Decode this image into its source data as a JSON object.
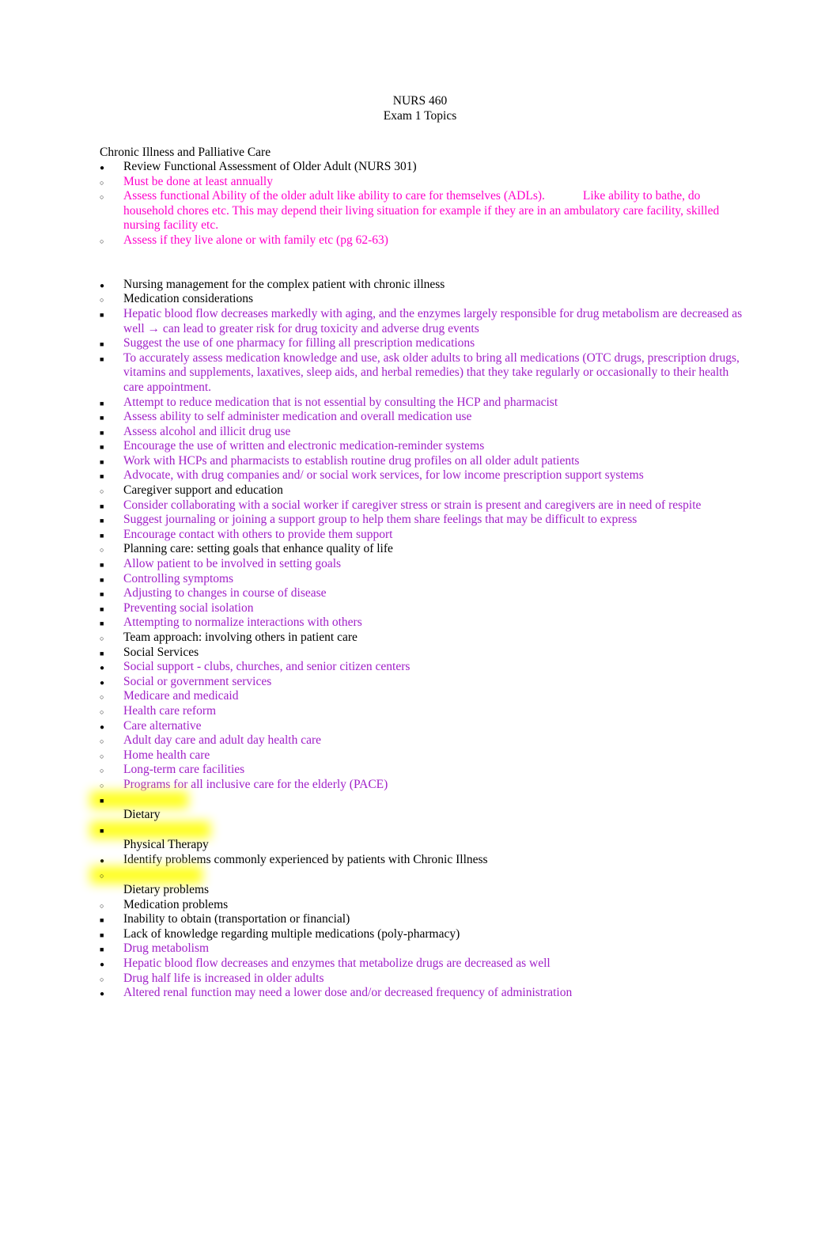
{
  "document": {
    "header": {
      "course": "NURS 460",
      "subtitle": "Exam 1 Topics"
    },
    "section_title": "Chronic Illness and Palliative Care",
    "colors": {
      "black": "#000000",
      "magenta": "#ff00cc",
      "purple": "#a020c8",
      "highlight": "#ffff00"
    },
    "items": [
      {
        "id": "i1",
        "level": 1,
        "marker": "disc",
        "color": "black",
        "text": "Review Functional Assessment of Older Adult (NURS 301)"
      },
      {
        "id": "i2",
        "level": 2,
        "marker": "circle",
        "color": "magenta",
        "text": "Must be done at least annually"
      },
      {
        "id": "i3",
        "level": 2,
        "marker": "circle",
        "color": "magenta",
        "text_a": "Assess functional Ability of the older adult like ability to care for themselves (ADLs).",
        "text_b": "Like ability to bathe, do household chores etc. This may depend their living situation for example if they are in an ambulatory care facility, skilled nursing facility etc."
      },
      {
        "id": "i4",
        "level": 2,
        "marker": "circle",
        "color": "magenta",
        "text": "Assess if they live alone or with family etc (pg 62-63)"
      },
      {
        "id": "i5",
        "level": 1,
        "marker": "disc",
        "color": "black",
        "text": "Nursing management for the complex patient with chronic illness"
      },
      {
        "id": "i6",
        "level": 2,
        "marker": "circle",
        "color": "black",
        "text": "Medication considerations"
      },
      {
        "id": "i7",
        "level": 3,
        "marker": "square",
        "color": "purple",
        "text": "Hepatic blood flow decreases markedly with aging, and the enzymes largely responsible for drug metabolism are decreased as well → can lead to greater risk for drug toxicity and adverse drug events"
      },
      {
        "id": "i8",
        "level": 3,
        "marker": "square",
        "color": "purple",
        "text": "Suggest the use of one pharmacy for filling all prescription medications"
      },
      {
        "id": "i9",
        "level": 3,
        "marker": "square",
        "color": "purple",
        "text": "To accurately assess medication knowledge and use, ask older adults to bring all medications (OTC drugs, prescription drugs, vitamins and supplements, laxatives, sleep aids, and herbal remedies) that they take regularly or occasionally to their health care appointment."
      },
      {
        "id": "i10",
        "level": 3,
        "marker": "square",
        "color": "purple",
        "text": "Attempt to reduce medication that is not essential by consulting the HCP and pharmacist"
      },
      {
        "id": "i11",
        "level": 3,
        "marker": "square",
        "color": "purple",
        "text": "Assess ability to self administer medication and overall medication use"
      },
      {
        "id": "i12",
        "level": 3,
        "marker": "square",
        "color": "purple",
        "text": "Assess alcohol and illicit drug use"
      },
      {
        "id": "i13",
        "level": 3,
        "marker": "square",
        "color": "purple",
        "text": "Encourage the use of written and electronic medication-reminder systems"
      },
      {
        "id": "i14",
        "level": 3,
        "marker": "square",
        "color": "purple",
        "text": "Work with HCPs and pharmacists to establish routine drug profiles on all older adult patients"
      },
      {
        "id": "i15",
        "level": 3,
        "marker": "square",
        "color": "purple",
        "text": "Advocate, with drug companies and/ or social work services, for low income prescription support systems"
      },
      {
        "id": "i16",
        "level": 2,
        "marker": "circle",
        "color": "black",
        "text": "Caregiver support and education"
      },
      {
        "id": "i17",
        "level": 3,
        "marker": "square",
        "color": "purple",
        "text": "Consider collaborating with a social worker if caregiver stress or strain is present and caregivers are in need of respite"
      },
      {
        "id": "i18",
        "level": 3,
        "marker": "square",
        "color": "purple",
        "text": "Suggest journaling or joining a support group to help them share feelings that may be difficult to express"
      },
      {
        "id": "i19",
        "level": 3,
        "marker": "square",
        "color": "purple",
        "text": "Encourage contact with others to provide them support"
      },
      {
        "id": "i20",
        "level": 2,
        "marker": "circle",
        "color": "black",
        "text": "Planning care: setting goals that enhance quality of life"
      },
      {
        "id": "i21",
        "level": 3,
        "marker": "square",
        "color": "purple",
        "text": "Allow patient to be involved in setting goals"
      },
      {
        "id": "i22",
        "level": 3,
        "marker": "square",
        "color": "purple",
        "text": "Controlling symptoms"
      },
      {
        "id": "i23",
        "level": 3,
        "marker": "square",
        "color": "purple",
        "text": "Adjusting to changes in course of disease"
      },
      {
        "id": "i24",
        "level": 3,
        "marker": "square",
        "color": "purple",
        "text": "Preventing social isolation"
      },
      {
        "id": "i25",
        "level": 3,
        "marker": "square",
        "color": "purple",
        "text": "Attempting to normalize interactions with others"
      },
      {
        "id": "i26",
        "level": 2,
        "marker": "circle",
        "color": "black",
        "text": "Team approach: involving others in patient care"
      },
      {
        "id": "i27",
        "level": 3,
        "marker": "square",
        "color": "black",
        "text": "Social Services"
      },
      {
        "id": "i28",
        "level": 4,
        "marker": "disc",
        "color": "purple",
        "text": "Social support - clubs, churches, and senior citizen centers"
      },
      {
        "id": "i29",
        "level": 4,
        "marker": "disc",
        "color": "purple",
        "text": "Social or government services"
      },
      {
        "id": "i30",
        "level": 5,
        "marker": "circle",
        "color": "purple",
        "text": "Medicare and medicaid"
      },
      {
        "id": "i31",
        "level": 5,
        "marker": "circle",
        "color": "purple",
        "text": "Health care reform"
      },
      {
        "id": "i32",
        "level": 4,
        "marker": "disc",
        "color": "purple",
        "text": "Care alternative"
      },
      {
        "id": "i33",
        "level": 5,
        "marker": "circle",
        "color": "purple",
        "text": "Adult day care and adult day health care"
      },
      {
        "id": "i34",
        "level": 5,
        "marker": "circle",
        "color": "purple",
        "text": "Home health care"
      },
      {
        "id": "i35",
        "level": 5,
        "marker": "circle",
        "color": "purple",
        "text": "Long-term care facilities"
      },
      {
        "id": "i36",
        "level": 5,
        "marker": "circle",
        "color": "purple",
        "text": "Programs for all inclusive care for the elderly (PACE)"
      },
      {
        "id": "i37",
        "level": 3,
        "marker": "square",
        "color": "black",
        "text": "Dietary",
        "highlighted": true
      },
      {
        "id": "i38",
        "level": 3,
        "marker": "square",
        "color": "black",
        "text": "Physical Therapy",
        "highlighted": true
      },
      {
        "id": "i39",
        "level": 1,
        "marker": "disc",
        "color": "black",
        "text": "Identify problems commonly experienced by patients with Chronic Illness"
      },
      {
        "id": "i40",
        "level": 2,
        "marker": "circle",
        "color": "black",
        "text": "Dietary problems",
        "highlighted": true
      },
      {
        "id": "i41",
        "level": 2,
        "marker": "circle",
        "color": "black",
        "text": "Medication problems"
      },
      {
        "id": "i42",
        "level": 3,
        "marker": "square",
        "color": "black",
        "text": "Inability to obtain (transportation or financial)"
      },
      {
        "id": "i43",
        "level": 3,
        "marker": "square",
        "color": "black",
        "text": "Lack of knowledge regarding multiple medications (poly-pharmacy)"
      },
      {
        "id": "i44",
        "level": 3,
        "marker": "square",
        "color": "purple",
        "text": "Drug metabolism"
      },
      {
        "id": "i45",
        "level": 4,
        "marker": "disc",
        "color": "purple",
        "text": "Hepatic blood flow decreases and enzymes that metabolize drugs are decreased as well"
      },
      {
        "id": "i46",
        "level": 5,
        "marker": "circle",
        "color": "purple",
        "text": "Drug half life is increased in older adults"
      },
      {
        "id": "i47",
        "level": 4,
        "marker": "disc",
        "color": "purple",
        "text": "Altered renal function may need a lower dose and/or decreased frequency of administration"
      }
    ]
  }
}
